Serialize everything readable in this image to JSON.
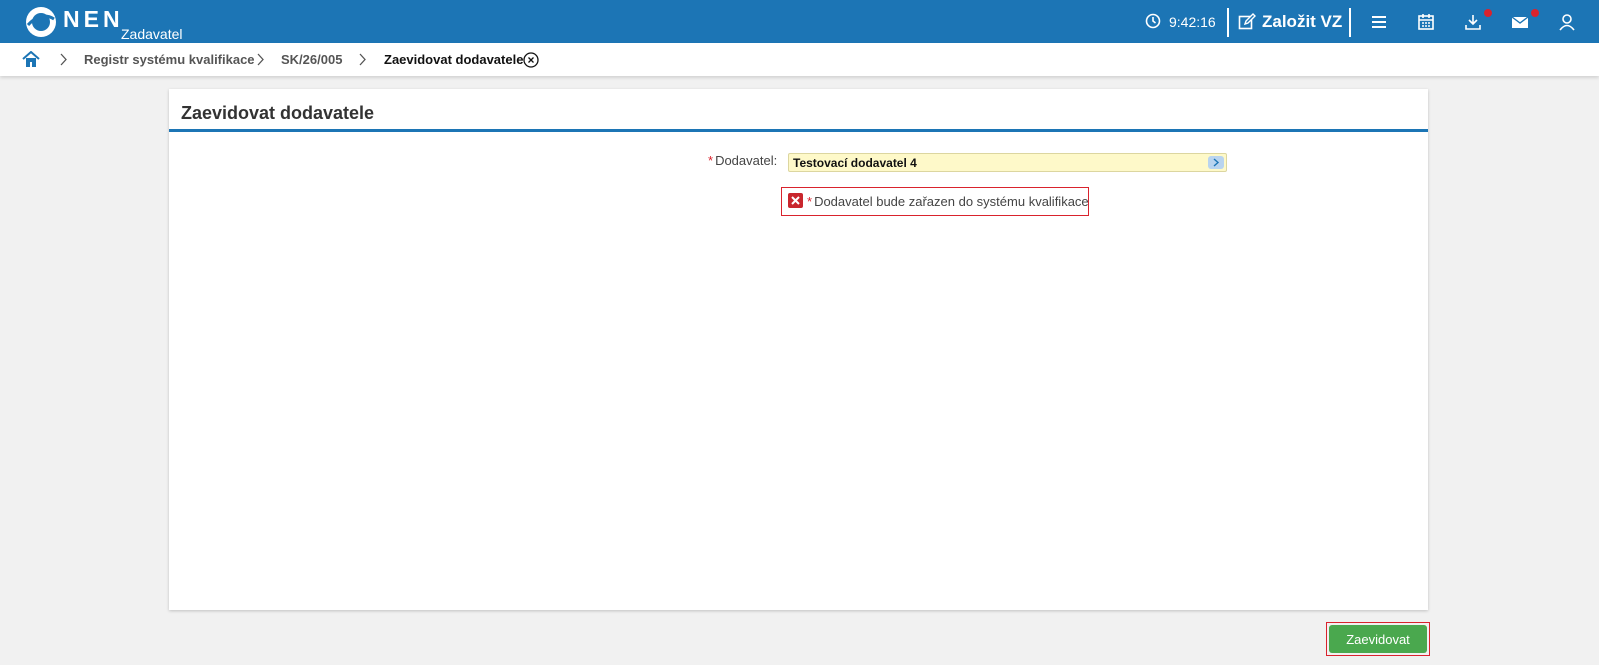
{
  "header": {
    "logo_text": "NEN",
    "logo_sub": "Zadavatel",
    "time": "9:42:16",
    "create_label": "Založit VZ",
    "icons": [
      "clock-icon",
      "edit-icon",
      "menu-icon",
      "calendar-icon",
      "download-icon",
      "mail-icon",
      "user-icon"
    ],
    "accent_color": "#1c75b5",
    "notification_color": "#d9232d"
  },
  "breadcrumb": {
    "items": [
      "Registr systému kvalifikace",
      "SK/26/005",
      "Zaevidovat dodavatele"
    ]
  },
  "panel": {
    "title": "Zaevidovat dodavatele",
    "required_mark": "*",
    "supplier_label": "Dodavatel:",
    "supplier_value": "Testovací dodavatel 4",
    "checkbox_label": "Dodavatel bude zařazen do systému kvalifikace",
    "checkbox_checked": false
  },
  "actions": {
    "submit_label": "Zaevidovat",
    "submit_color": "#4aa84e"
  }
}
